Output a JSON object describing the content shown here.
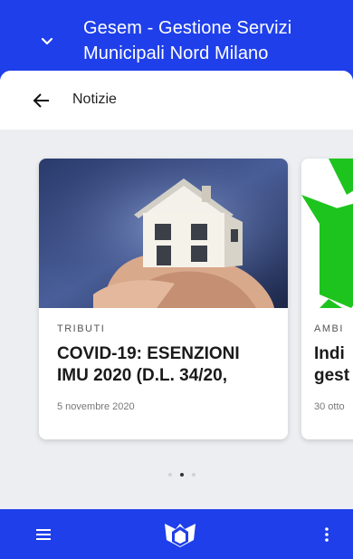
{
  "header": {
    "title_line1": "Gesem - Gestione Servizi",
    "title_line2": "Municipali Nord Milano"
  },
  "news_bar": {
    "title": "Notizie"
  },
  "cards": [
    {
      "category": "TRIBUTI",
      "headline_line1": "COVID-19: ESENZIONI",
      "headline_line2": "IMU 2020 (D.L. 34/20,",
      "date": "5 novembre 2020"
    },
    {
      "category": "AMBI",
      "headline_line1": "Indi",
      "headline_line2": "gest",
      "date": "30 otto"
    }
  ],
  "pagination": {
    "count": 3,
    "active_index": 1
  },
  "icons": {
    "chevron": "chevron-down-icon",
    "back": "arrow-left-icon",
    "menu": "hamburger-menu-icon",
    "logo": "gesem-logo-icon",
    "more": "more-vertical-icon"
  },
  "colors": {
    "brand_blue": "#1f3fea",
    "sheet_bg": "#eceef1",
    "recycle_green": "#1ec41e"
  }
}
